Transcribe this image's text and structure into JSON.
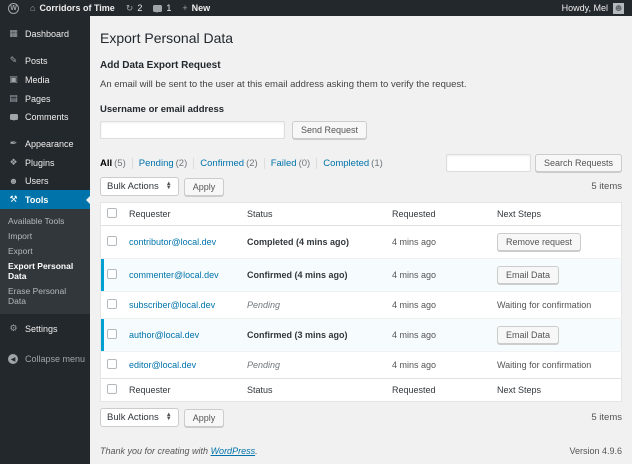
{
  "admin_bar": {
    "site_name": "Corridors of Time",
    "updates_count": "2",
    "comments_count": "1",
    "new_label": "New",
    "howdy": "Howdy, Mel"
  },
  "icons": {
    "wp_logo": "W",
    "home": "⌂",
    "updates": "↻",
    "new": "+",
    "dashboard": "▦",
    "posts": "✎",
    "media": "▣",
    "pages": "▤",
    "appearance": "✒",
    "plugins": "❖",
    "users": "☻",
    "tools": "⚒",
    "settings": "⚙",
    "collapse": "◀",
    "avatar": "☻",
    "select_arrows_up": "▲",
    "select_arrows_down": "▼"
  },
  "sidebar": {
    "items": [
      {
        "label": "Dashboard"
      },
      {
        "label": "Posts"
      },
      {
        "label": "Media"
      },
      {
        "label": "Pages"
      },
      {
        "label": "Comments"
      },
      {
        "label": "Appearance"
      },
      {
        "label": "Plugins"
      },
      {
        "label": "Users"
      },
      {
        "label": "Tools"
      }
    ],
    "tools_submenu": [
      {
        "label": "Available Tools"
      },
      {
        "label": "Import"
      },
      {
        "label": "Export"
      },
      {
        "label": "Export Personal Data"
      },
      {
        "label": "Erase Personal Data"
      }
    ],
    "settings_label": "Settings",
    "collapse_label": "Collapse menu"
  },
  "page": {
    "title": "Export Personal Data",
    "section_title": "Add Data Export Request",
    "description": "An email will be sent to the user at this email address asking them to verify the request.",
    "username_label": "Username or email address",
    "username_value": "",
    "send_button": "Send Request"
  },
  "filters": [
    {
      "label": "All",
      "count": "(5)"
    },
    {
      "label": "Pending",
      "count": "(2)"
    },
    {
      "label": "Confirmed",
      "count": "(2)"
    },
    {
      "label": "Failed",
      "count": "(0)"
    },
    {
      "label": "Completed",
      "count": "(1)"
    }
  ],
  "toolbar": {
    "bulk_actions_label": "Bulk Actions",
    "apply_label": "Apply",
    "search_value": "",
    "search_button": "Search Requests",
    "items_count": "5 items"
  },
  "table": {
    "columns": [
      "Requester",
      "Status",
      "Requested",
      "Next Steps"
    ],
    "rows": [
      {
        "requester": "contributor@local.dev",
        "status": "Completed (4 mins ago)",
        "requested": "4 mins ago",
        "next_steps": "Remove request"
      },
      {
        "requester": "commenter@local.dev",
        "status": "Confirmed (4 mins ago)",
        "requested": "4 mins ago",
        "next_steps": "Email Data"
      },
      {
        "requester": "subscriber@local.dev",
        "status": "Pending",
        "requested": "4 mins ago",
        "next_steps": "Waiting for confirmation"
      },
      {
        "requester": "author@local.dev",
        "status": "Confirmed (3 mins ago)",
        "requested": "4 mins ago",
        "next_steps": "Email Data"
      },
      {
        "requester": "editor@local.dev",
        "status": "Pending",
        "requested": "4 mins ago",
        "next_steps": "Waiting for confirmation"
      }
    ]
  },
  "footer": {
    "thanks_prefix": "Thank you for creating with ",
    "wordpress_link": "WordPress",
    "thanks_suffix": ".",
    "version": "Version 4.9.6"
  },
  "colors": {
    "accent": "#0073aa",
    "admin_bar_bg": "#23282d",
    "submenu_bg": "#32373c",
    "highlight_border": "#00a0d2",
    "highlight_bg": "#f6fbfe",
    "content_bg": "#f1f1f1"
  }
}
